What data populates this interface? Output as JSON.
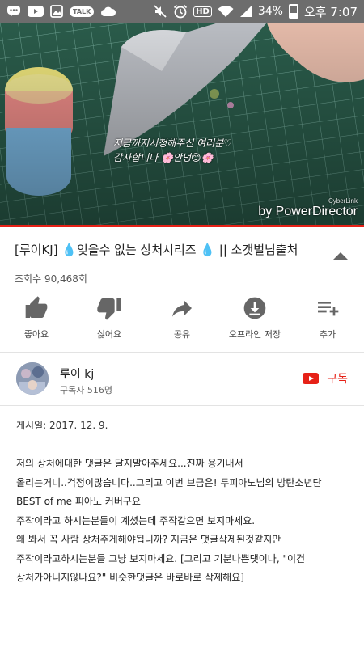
{
  "status_bar": {
    "battery": "34%",
    "time": "오후 7:07",
    "icons": [
      "chat-icon",
      "youtube-icon",
      "gallery-icon",
      "talk-icon",
      "cloud-icon",
      "mute-icon",
      "alarm-icon",
      "hd-icon",
      "wifi-icon",
      "signal-icon",
      "battery-icon"
    ]
  },
  "video": {
    "overlay_text_line1": "지금까지시청해주신 여러분♡",
    "overlay_text_line2": "감사합니다 🌸안녕😊🌸",
    "watermark_small": "CyberLink",
    "watermark": "by PowerDirector",
    "progress": 1.0
  },
  "title": "[루이KJ] 💧잊을수 없는 상처시리즈 💧 || 소갯벌님출처",
  "views": "조회수 90,468회",
  "actions": [
    {
      "label": "좋아요",
      "icon": "thumbs-up-icon"
    },
    {
      "label": "싫어요",
      "icon": "thumbs-down-icon"
    },
    {
      "label": "공유",
      "icon": "share-icon"
    },
    {
      "label": "오프라인 저장",
      "icon": "download-icon"
    },
    {
      "label": "추가",
      "icon": "playlist-add-icon"
    }
  ],
  "channel": {
    "name": "루이 kj",
    "subscribers": "구독자 516명",
    "subscribe_label": "구독"
  },
  "description": {
    "posted": "게시일: 2017. 12. 9.",
    "lines": [
      "저의 상처에대한 댓글은 달지말아주세요...진짜 용기내서",
      "올리는거니..걱정이많습니다..그리고 이번 브금은! 두피아노님의 방탄소년단",
      "BEST of me 피아노 커버구요",
      "주작이라고 하시는분들이 계셨는데 주작같으면 보지마세요.",
      "왜 봐서 꼭 사람 상처주게해야됩니까? 지금은 댓글삭제된것같지만",
      "주작이라고하시는분들 그냥 보지마세요. [그리고 기분나쁜댓이나, \"이건",
      "상처가아니지않나요?\" 비슷한댓글은 바로바로 삭제해요]"
    ]
  }
}
